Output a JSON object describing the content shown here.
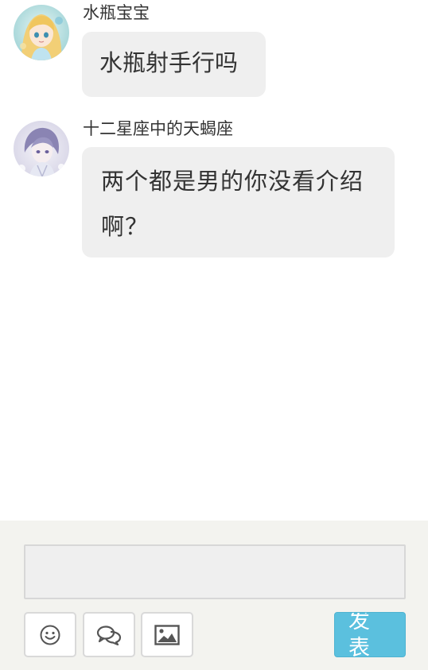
{
  "messages": [
    {
      "sender": "水瓶宝宝",
      "avatar": "avatar-blonde-anime-girl",
      "text": "水瓶射手行吗"
    },
    {
      "sender": "十二星座中的天蝎座",
      "avatar": "avatar-anime-boy-white-hair",
      "text": "两个都是男的你没看介绍啊？"
    }
  ],
  "composer": {
    "input_value": "",
    "emoji_icon": "smiley-icon",
    "chat_icon": "speech-bubbles-icon",
    "image_icon": "picture-icon",
    "submit_label": "发表"
  },
  "colors": {
    "bubble": "#efefef",
    "composer_bg": "#f3f3ef",
    "submit": "#5bc0de"
  }
}
